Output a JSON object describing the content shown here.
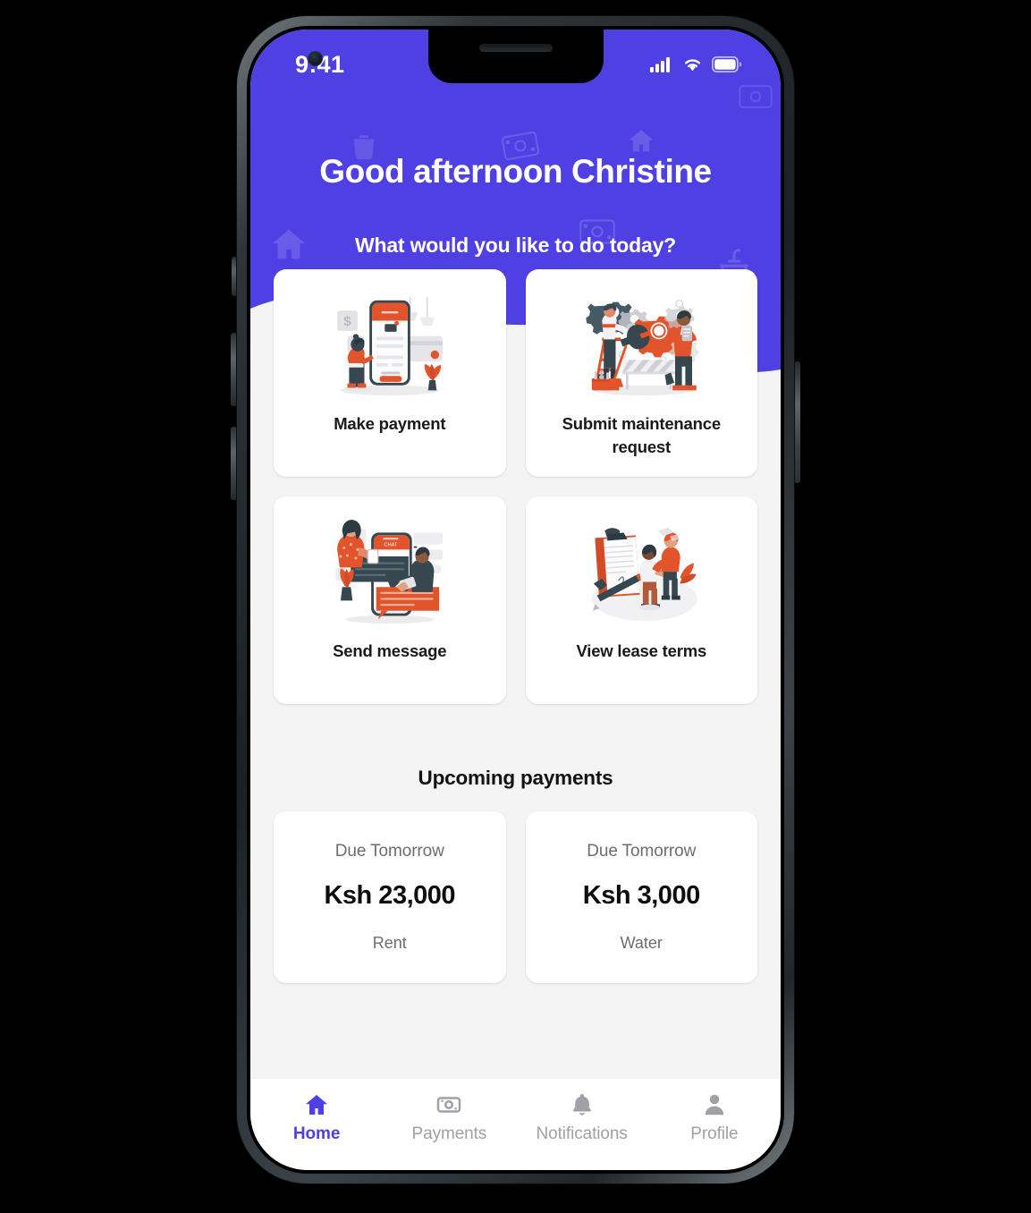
{
  "colors": {
    "brand_purple": "#4F40E4",
    "screen_bg": "#F4F4F5",
    "card_bg": "#FFFFFF",
    "muted_text": "#6D6D72",
    "nav_inactive": "#A0A0A6",
    "illustration_orange": "#E2542C",
    "illustration_dark": "#37474F"
  },
  "status_bar": {
    "time": "9:41",
    "icons": [
      "cellular-signal-icon",
      "wifi-icon",
      "battery-icon"
    ]
  },
  "header": {
    "greeting": "Good afternoon Christine",
    "subgreeting": "What would you like to do today?",
    "watermark_icons": [
      "trash-bin-icon",
      "banknote-icon",
      "house-icon",
      "faucet-icon"
    ]
  },
  "actions": [
    {
      "label": "Make payment",
      "icon": "make-payment-illustration"
    },
    {
      "label": "Submit maintenance request",
      "icon": "maintenance-illustration"
    },
    {
      "label": "Send message",
      "icon": "send-message-illustration"
    },
    {
      "label": "View lease terms",
      "icon": "lease-terms-illustration"
    }
  ],
  "upcoming": {
    "title": "Upcoming payments",
    "items": [
      {
        "due": "Due Tomorrow",
        "amount": "Ksh 23,000",
        "type": "Rent"
      },
      {
        "due": "Due Tomorrow",
        "amount": "Ksh 3,000",
        "type": "Water"
      }
    ]
  },
  "bottom_nav": {
    "items": [
      {
        "label": "Home",
        "icon": "home-icon",
        "active": true
      },
      {
        "label": "Payments",
        "icon": "banknote-icon",
        "active": false
      },
      {
        "label": "Notifications",
        "icon": "bell-icon",
        "active": false
      },
      {
        "label": "Profile",
        "icon": "person-icon",
        "active": false
      }
    ]
  }
}
